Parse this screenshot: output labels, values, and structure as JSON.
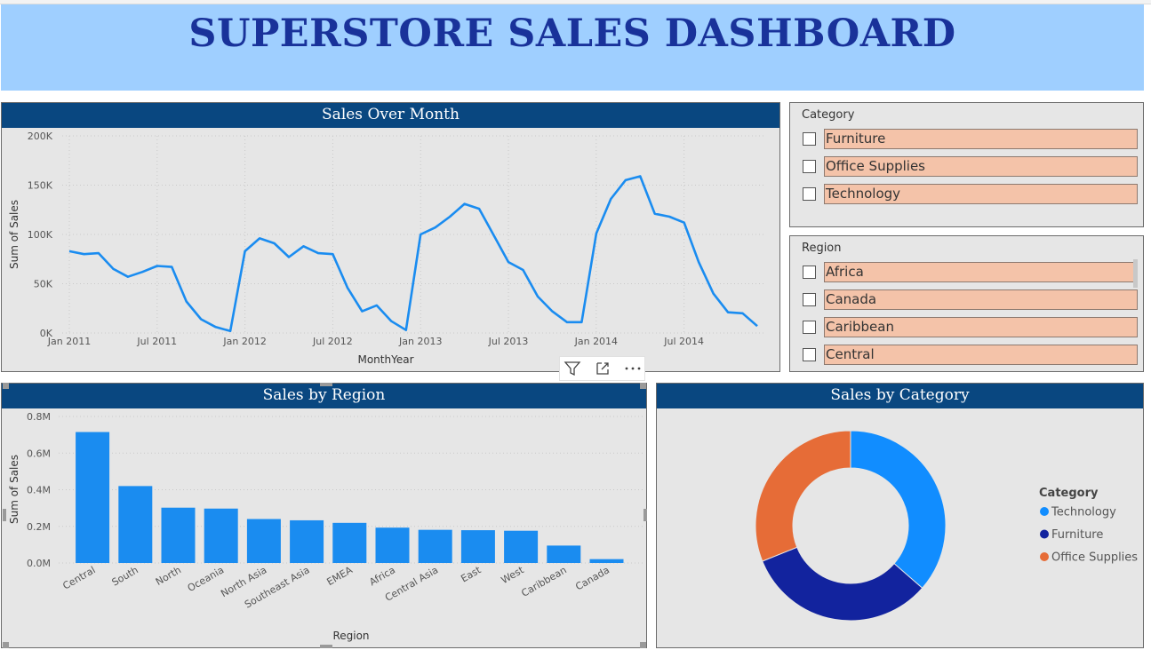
{
  "dashboard": {
    "title": "SUPERSTORE SALES DASHBOARD"
  },
  "line_chart": {
    "title": "Sales Over Month"
  },
  "bar_chart": {
    "title": "Sales by Region"
  },
  "donut_chart": {
    "title": "Sales by Category"
  },
  "category_slicer": {
    "title": "Category",
    "items": [
      "Furniture",
      "Office Supplies",
      "Technology"
    ]
  },
  "region_slicer": {
    "title": "Region",
    "items": [
      "Africa",
      "Canada",
      "Caribbean",
      "Central"
    ]
  },
  "colors": {
    "header_bg": "#9fcfff",
    "title_text": "#19329a",
    "panel_title_bg": "#094780",
    "line": "#1a8cf0",
    "bar": "#1a8cf0",
    "technology": "#118dff",
    "furniture": "#12239e",
    "office_supplies": "#e66c37",
    "slicer_item_bg": "#f4c3a9"
  },
  "icons": {
    "filter": "filter-icon",
    "focus_mode": "focus-mode-icon",
    "more_options": "more-options-icon"
  },
  "chart_data": [
    {
      "type": "line",
      "title": "Sales Over Month",
      "xlabel": "MonthYear",
      "ylabel": "Sum of Sales",
      "x_ticks": [
        "Jan 2011",
        "Jul 2011",
        "Jan 2012",
        "Jul 2012",
        "Jan 2013",
        "Jul 2013",
        "Jan 2014",
        "Jul 2014"
      ],
      "y_ticks": [
        "0K",
        "50K",
        "100K",
        "150K",
        "200K"
      ],
      "ylim": [
        0,
        200000
      ],
      "grid": true,
      "series": [
        {
          "values": [
            83000,
            80000,
            81000,
            65000,
            57000,
            62000,
            68000,
            67000,
            32000,
            14000,
            6000,
            2000,
            83000,
            96000,
            91000,
            77000,
            88000,
            81000,
            80000,
            46000,
            22000,
            28000,
            12000,
            3000,
            100000,
            107000,
            118000,
            131000,
            126000,
            99000,
            72000,
            64000,
            37000,
            22000,
            11000,
            11000,
            101000,
            136000,
            155000,
            159000,
            121000,
            118000,
            112000,
            72000,
            40000,
            21000,
            20000,
            7000
          ]
        }
      ]
    },
    {
      "type": "bar",
      "title": "Sales by Region",
      "xlabel": "Region",
      "ylabel": "Sum of Sales",
      "categories": [
        "Central",
        "South",
        "North",
        "Oceania",
        "North Asia",
        "Southeast Asia",
        "EMEA",
        "Africa",
        "Central Asia",
        "East",
        "West",
        "Caribbean",
        "Canada"
      ],
      "values": [
        715000,
        420000,
        302000,
        297000,
        240000,
        233000,
        219000,
        193000,
        181000,
        179000,
        176000,
        95000,
        21000
      ],
      "y_ticks": [
        "0.0M",
        "0.2M",
        "0.4M",
        "0.6M",
        "0.8M"
      ],
      "ylim": [
        0,
        800000
      ],
      "grid": true
    },
    {
      "type": "pie",
      "title": "Sales by Category",
      "legend_title": "Category",
      "legend": "right",
      "labels": [
        "Technology",
        "Furniture",
        "Office Supplies"
      ],
      "values": [
        36.4,
        32.5,
        31.1
      ]
    }
  ]
}
